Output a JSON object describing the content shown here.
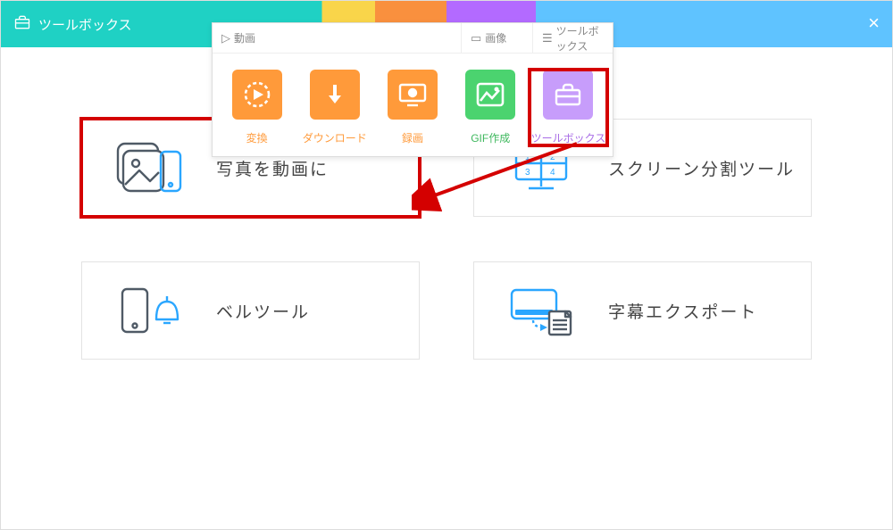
{
  "header": {
    "title": "ツールボックス"
  },
  "dropdown": {
    "tabs": {
      "video": "動画",
      "image": "画像",
      "toolbox": "ツールボックス"
    },
    "items": [
      {
        "label": "変換"
      },
      {
        "label": "ダウンロード"
      },
      {
        "label": "録画"
      },
      {
        "label": "GIF作成"
      },
      {
        "label": "ツールボックス"
      }
    ]
  },
  "cards": {
    "photo_to_video": "写真を動画に",
    "screen_split": "スクリーン分割ツール",
    "bell_tool": "ベルツール",
    "subtitle_export": "字幕エクスポート"
  }
}
